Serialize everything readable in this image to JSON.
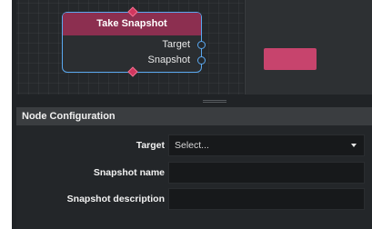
{
  "node": {
    "title": "Take Snapshot",
    "ports": [
      {
        "label": "Target"
      },
      {
        "label": "Snapshot"
      }
    ]
  },
  "config": {
    "header": "Node Configuration",
    "target": {
      "label": "Target",
      "value": "Select..."
    },
    "snapshot_name": {
      "label": "Snapshot name",
      "value": ""
    },
    "snapshot_description": {
      "label": "Snapshot description",
      "value": ""
    }
  },
  "colors": {
    "node_header": "#8c2f50",
    "node_border": "#5aa8f0",
    "preview_shape": "#c7446d",
    "panel_background": "#232629"
  },
  "icons": [
    "chevron-down-icon",
    "flow-in-diamond-icon",
    "flow-out-diamond-icon"
  ]
}
